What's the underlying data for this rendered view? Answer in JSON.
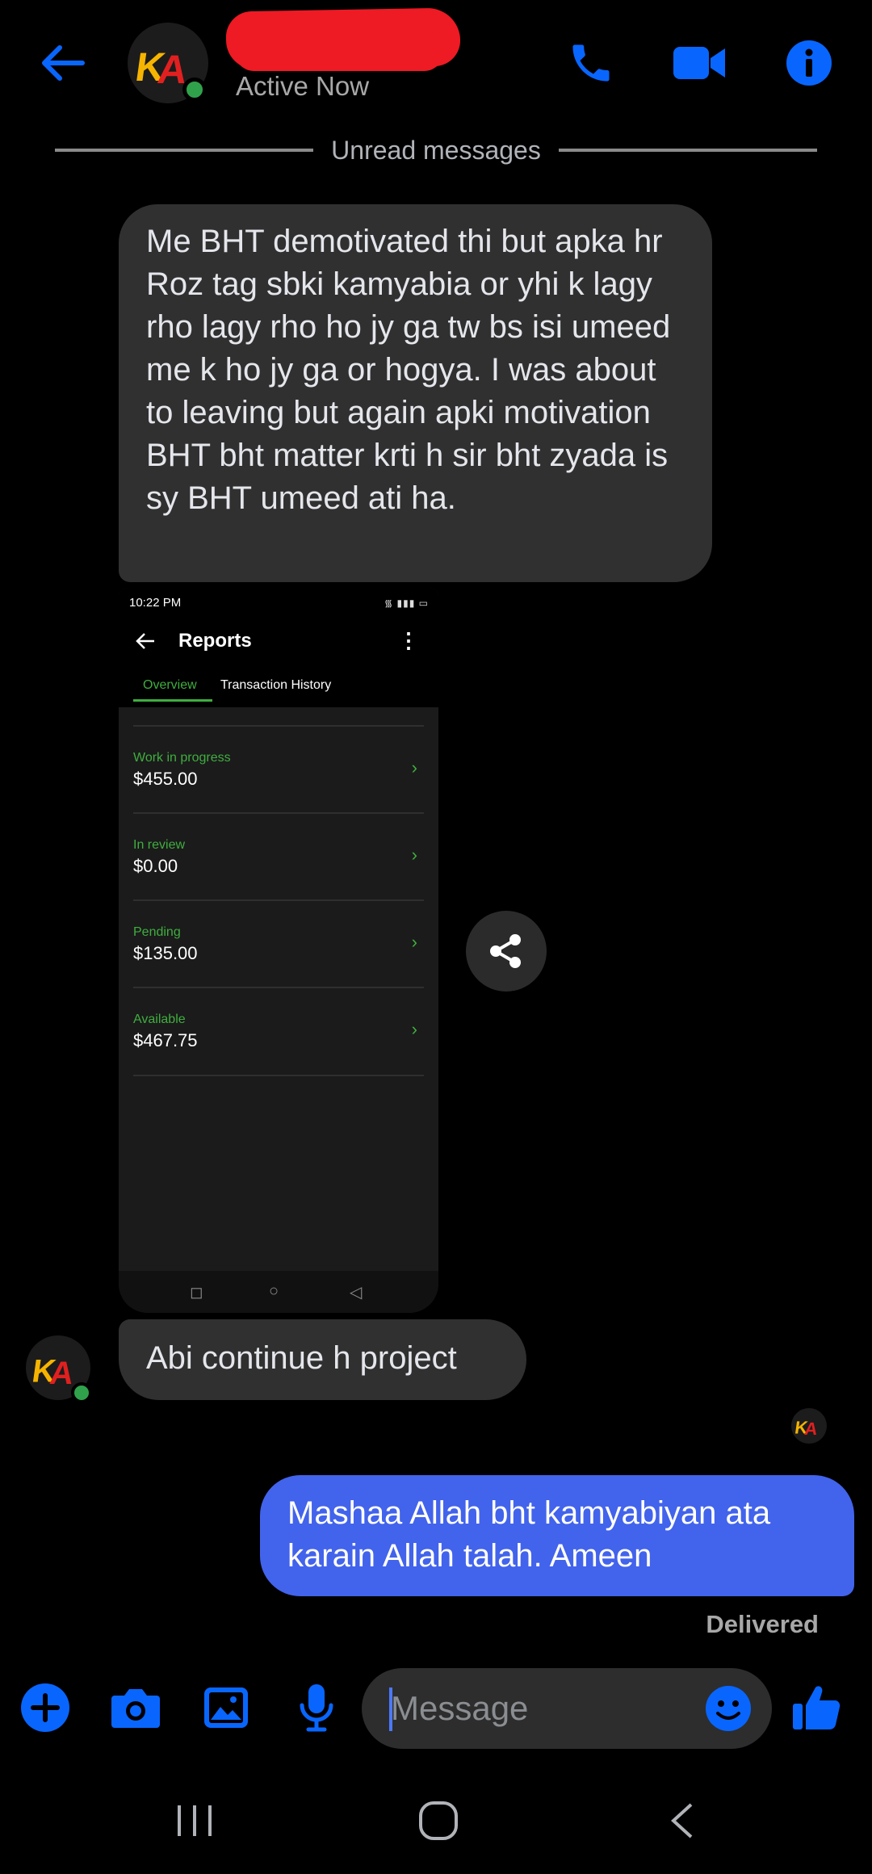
{
  "header": {
    "status": "Active Now",
    "avatar_text": "KA"
  },
  "divider": {
    "label": "Unread messages"
  },
  "messages": {
    "m1": "Me BHT demotivated thi but apka hr Roz tag sbki kamyabia or yhi k lagy rho lagy rho ho jy ga tw bs isi umeed me k ho jy ga or hogya. I was about to leaving but again apki motivation BHT bht matter krti h sir bht zyada is sy BHT umeed ati ha.",
    "m2": "Abi continue h project",
    "m3": "Mashaa Allah bht kamyabiyan ata karain Allah talah. Ameen",
    "delivered": "Delivered"
  },
  "screenshot": {
    "time": "10:22 PM",
    "title": "Reports",
    "tabs": [
      "Overview",
      "Transaction History"
    ],
    "rows": [
      {
        "label": "Work in progress",
        "value": "$455.00"
      },
      {
        "label": "In review",
        "value": "$0.00"
      },
      {
        "label": "Pending",
        "value": "$135.00"
      },
      {
        "label": "Available",
        "value": "$467.75"
      }
    ]
  },
  "composer": {
    "placeholder": "Message"
  },
  "colors": {
    "accent": "#0866ff",
    "outgoing_bubble": "#4263eb",
    "incoming_bubble": "#303030",
    "online": "#31a24c",
    "report_green": "#3fae3f"
  },
  "icons": {
    "header": [
      "back-arrow-icon",
      "phone-icon",
      "video-camera-icon",
      "info-icon"
    ],
    "composer": [
      "plus-icon",
      "camera-icon",
      "gallery-icon",
      "microphone-icon",
      "emoji-icon",
      "thumbs-up-icon"
    ],
    "system": [
      "recent-apps-icon",
      "home-icon",
      "back-icon"
    ]
  }
}
